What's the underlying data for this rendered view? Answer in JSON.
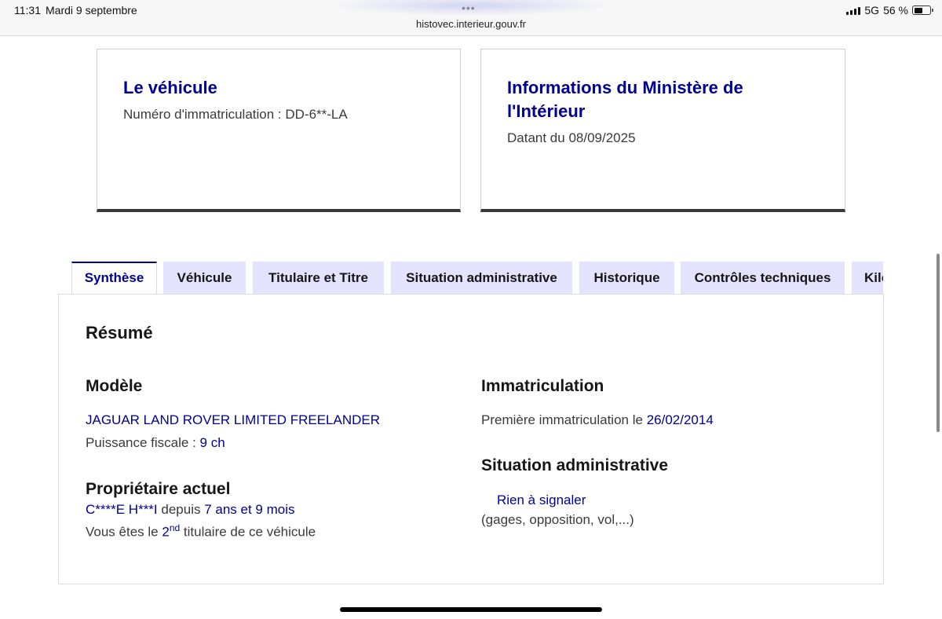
{
  "statusbar": {
    "time": "11:31",
    "date": "Mardi 9 septembre",
    "dots": "•••",
    "url": "histovec.interieur.gouv.fr",
    "network": "5G",
    "battery": "56 %",
    "battery_level": 0.56
  },
  "cards": {
    "vehicle": {
      "title": "Le véhicule",
      "subtitle": "Numéro d'immatriculation : DD-6**-LA"
    },
    "ministry": {
      "title": "Informations du Ministère de l'Intérieur",
      "subtitle": "Datant du 08/09/2025"
    }
  },
  "tabs": [
    {
      "label": "Synthèse",
      "active": true
    },
    {
      "label": "Véhicule",
      "active": false
    },
    {
      "label": "Titulaire et Titre",
      "active": false
    },
    {
      "label": "Situation administrative",
      "active": false
    },
    {
      "label": "Historique",
      "active": false
    },
    {
      "label": "Contrôles techniques",
      "active": false
    },
    {
      "label": "Kilométrage",
      "active": false
    }
  ],
  "summary": {
    "heading": "Résumé",
    "model": {
      "title": "Modèle",
      "name": "JAGUAR LAND ROVER LIMITED FREELANDER",
      "power_label": "Puissance fiscale : ",
      "power_value": "9 ch"
    },
    "owner": {
      "title": "Propriétaire actuel",
      "name": "C****E H***I",
      "since_label": " depuis ",
      "duration": "7 ans et 9 mois",
      "rank_prefix": "Vous êtes le ",
      "rank_number": "2",
      "rank_suffix": "nd",
      "rank_rest": " titulaire de ce véhicule"
    },
    "registration": {
      "title": "Immatriculation",
      "first_label": "Première immatriculation le ",
      "first_date": "26/02/2014"
    },
    "admin": {
      "title": "Situation administrative",
      "status": "Rien à signaler",
      "detail": "(gages, opposition, vol,...)"
    }
  },
  "colors": {
    "brand_blue": "#000091",
    "tab_bg": "#e3e3fd",
    "text": "#3a3a3a"
  }
}
